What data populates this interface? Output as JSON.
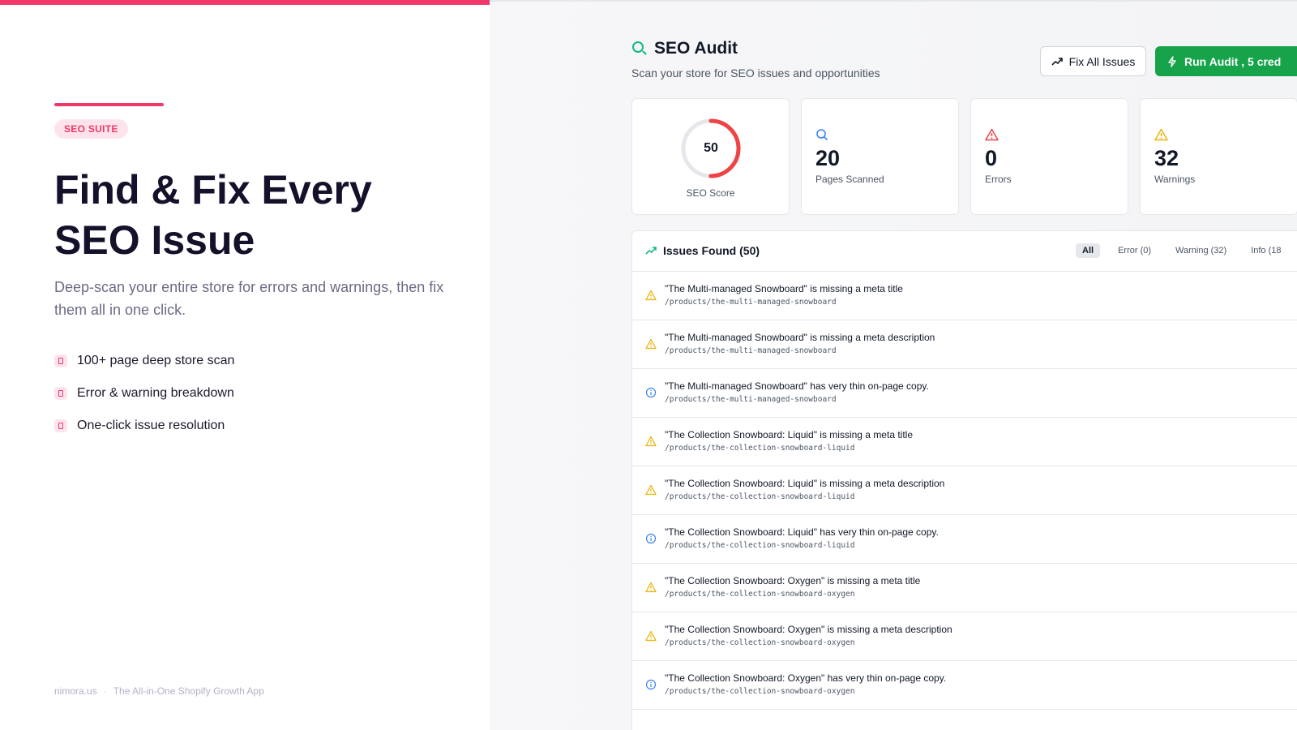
{
  "colors": {
    "brand_pink": "#f0386b",
    "score_red": "#ef4444",
    "score_track": "#e5e7eb",
    "success_green": "#16a34a",
    "warning_yellow": "#eab308",
    "info_blue": "#3b82f6",
    "error_red": "#ef4444"
  },
  "marketing": {
    "badge": "SEO SUITE",
    "headline_line1": "Find & Fix Every",
    "headline_line2": "SEO Issue",
    "subhead": "Deep-scan your entire store for errors and warnings, then fix them all in one click.",
    "features": [
      {
        "icon": "bookmark-icon",
        "label": "100+ page deep store scan"
      },
      {
        "icon": "bookmark-icon",
        "label": "Error & warning breakdown"
      },
      {
        "icon": "bookmark-icon",
        "label": "One-click issue resolution"
      }
    ],
    "footer": {
      "site": "nimora.us",
      "separator": "·",
      "tagline": "The All-in-One Shopify Growth App"
    }
  },
  "app": {
    "title": "SEO Audit",
    "subtitle": "Scan your store for SEO issues and opportunities",
    "fix_all_label": "Fix All Issues",
    "run_audit_label": "Run Audit , 5 cred",
    "stats": {
      "seo_score": {
        "value": "50",
        "label": "SEO Score",
        "fraction": 0.5
      },
      "pages_scanned": {
        "value": "20",
        "label": "Pages Scanned"
      },
      "errors": {
        "value": "0",
        "label": "Errors"
      },
      "warnings": {
        "value": "32",
        "label": "Warnings"
      }
    },
    "issues": {
      "title": "Issues Found (50)",
      "filters": [
        {
          "label": "All",
          "active": true
        },
        {
          "label": "Error (0)",
          "active": false
        },
        {
          "label": "Warning (32)",
          "active": false
        },
        {
          "label": "Info (18",
          "active": false
        }
      ],
      "rows": [
        {
          "type": "warning",
          "title": "\"The Multi-managed Snowboard\" is missing a meta title",
          "path": "/products/the-multi-managed-snowboard"
        },
        {
          "type": "warning",
          "title": "\"The Multi-managed Snowboard\" is missing a meta description",
          "path": "/products/the-multi-managed-snowboard"
        },
        {
          "type": "info",
          "title": "\"The Multi-managed Snowboard\" has very thin on-page copy.",
          "path": "/products/the-multi-managed-snowboard"
        },
        {
          "type": "warning",
          "title": "\"The Collection Snowboard: Liquid\" is missing a meta title",
          "path": "/products/the-collection-snowboard-liquid"
        },
        {
          "type": "warning",
          "title": "\"The Collection Snowboard: Liquid\" is missing a meta description",
          "path": "/products/the-collection-snowboard-liquid"
        },
        {
          "type": "info",
          "title": "\"The Collection Snowboard: Liquid\" has very thin on-page copy.",
          "path": "/products/the-collection-snowboard-liquid"
        },
        {
          "type": "warning",
          "title": "\"The Collection Snowboard: Oxygen\" is missing a meta title",
          "path": "/products/the-collection-snowboard-oxygen"
        },
        {
          "type": "warning",
          "title": "\"The Collection Snowboard: Oxygen\" is missing a meta description",
          "path": "/products/the-collection-snowboard-oxygen"
        },
        {
          "type": "info",
          "title": "\"The Collection Snowboard: Oxygen\" has very thin on-page copy.",
          "path": "/products/the-collection-snowboard-oxygen"
        }
      ]
    }
  }
}
